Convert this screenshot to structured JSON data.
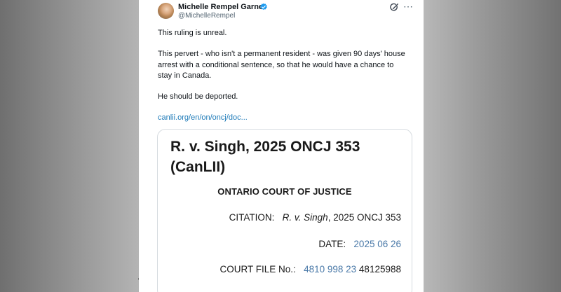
{
  "tweet": {
    "author_name": "Michelle Rempel Garner",
    "handle": "@MichelleRempel",
    "paragraphs": [
      "This ruling is unreal.",
      "This pervert - who isn't a permanent resident - was given 90 days' house arrest with a conditional sentence, so that he would have a chance to stay in Canada.",
      "He should be deported."
    ],
    "link_text": "canlii.org/en/on/oncj/doc..."
  },
  "card": {
    "case_title": "R. v. Singh, 2025 ONCJ 353 (CanLII)",
    "court": "ONTARIO COURT OF JUSTICE",
    "citation_label": "CITATION:",
    "citation_case": "R. v. Singh",
    "citation_rest": ", 2025 ONCJ 353",
    "date_label": "DATE:",
    "date_value": "2025 06 26",
    "file_label": "COURT FILE No.:",
    "file_number_linked": "4810 998 23",
    "file_number_plain": "48125988"
  },
  "icons": {
    "verified": "verified-badge-icon",
    "grok": "grok-icon",
    "more": "more-options-icon"
  },
  "colors": {
    "link": "#1d7ab8",
    "verified": "#1d9bf0",
    "card_accent": "#4a79a8"
  }
}
